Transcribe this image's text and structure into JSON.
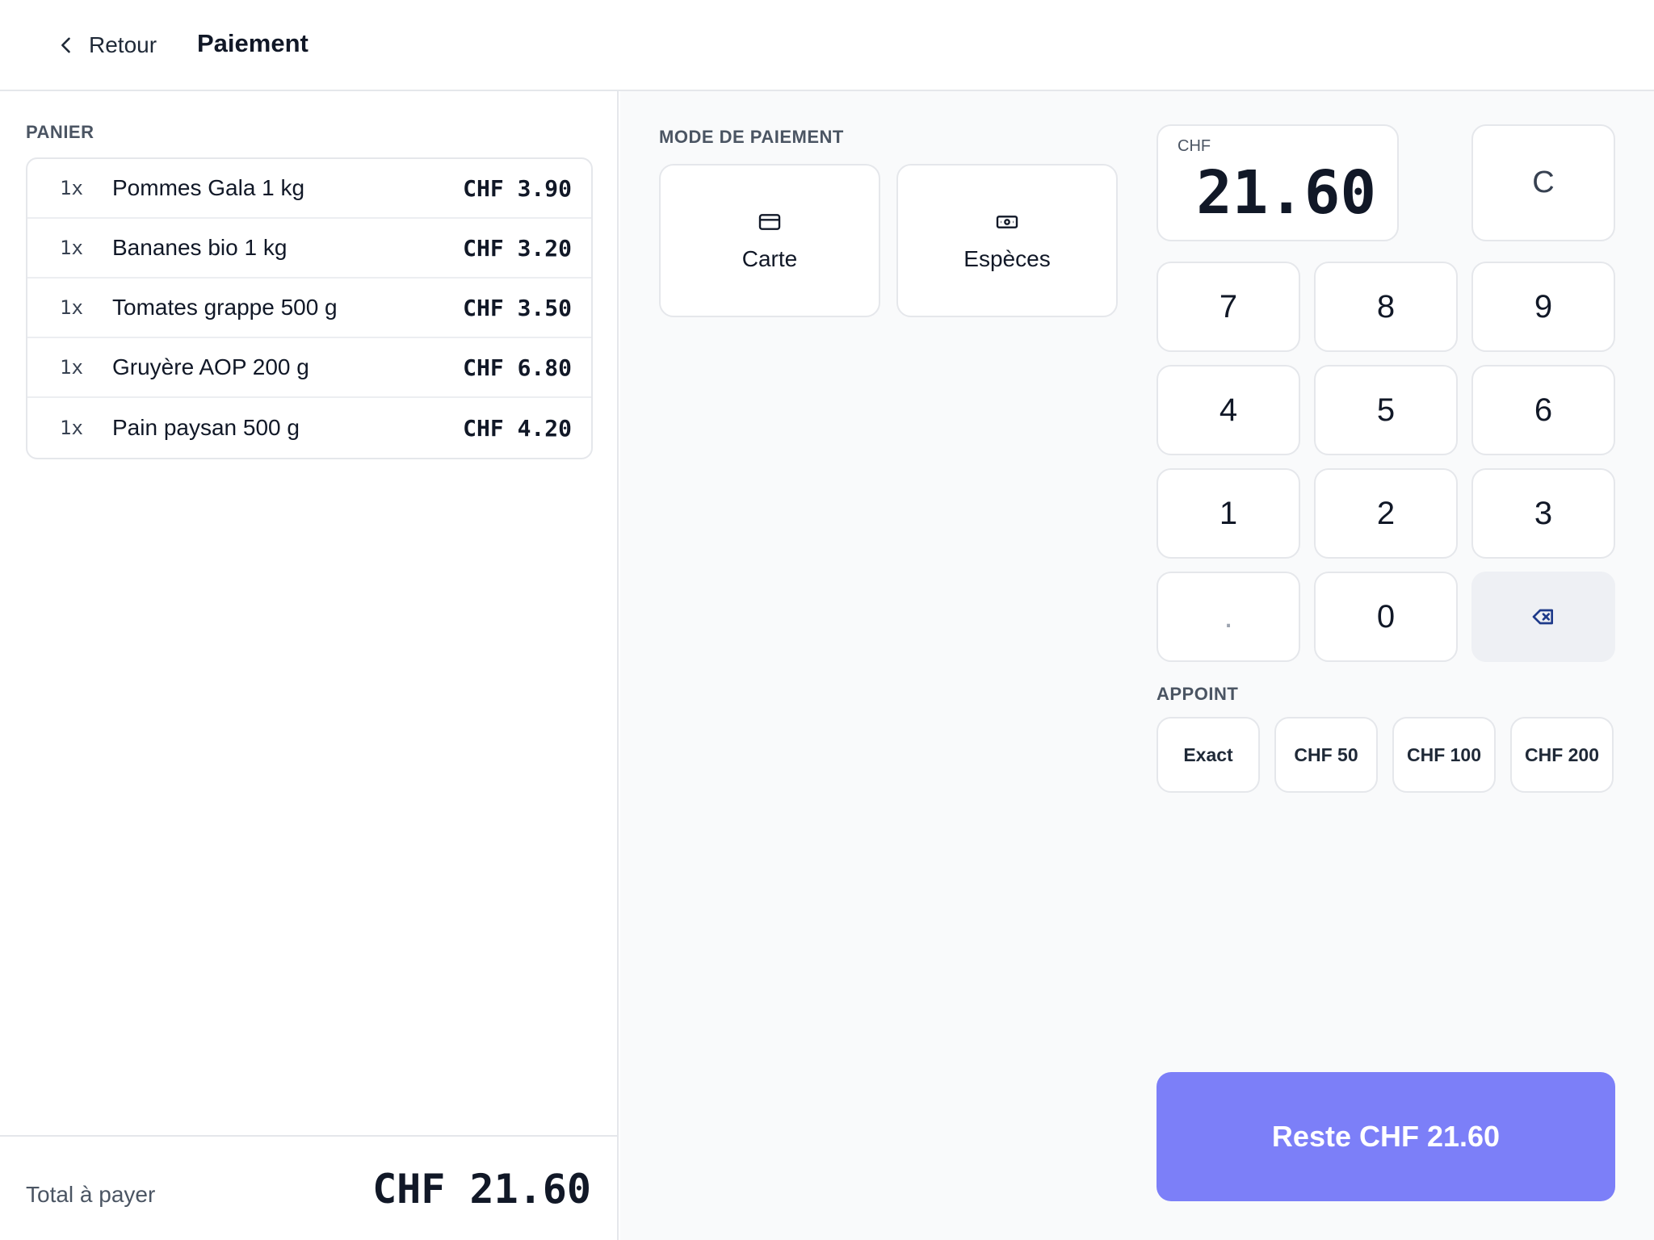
{
  "header": {
    "back_label": "Retour",
    "title": "Paiement"
  },
  "cart": {
    "label": "PANIER",
    "items": [
      {
        "qty": "1x",
        "name": "Pommes Gala 1 kg",
        "price": "CHF 3.90"
      },
      {
        "qty": "1x",
        "name": "Bananes bio 1 kg",
        "price": "CHF 3.20"
      },
      {
        "qty": "1x",
        "name": "Tomates grappe 500 g",
        "price": "CHF 3.50"
      },
      {
        "qty": "1x",
        "name": "Gruyère AOP 200 g",
        "price": "CHF 6.80"
      },
      {
        "qty": "1x",
        "name": "Pain paysan 500 g",
        "price": "CHF 4.20"
      }
    ],
    "total_label": "Total à payer",
    "total_value": "CHF 21.60"
  },
  "payment": {
    "label": "MODE DE PAIEMENT",
    "methods": [
      {
        "label": "Carte",
        "icon": "credit-card-icon"
      },
      {
        "label": "Espèces",
        "icon": "cash-icon"
      }
    ]
  },
  "keypad": {
    "currency": "CHF",
    "amount": "21.60",
    "clear_label": "C",
    "keys": [
      "7",
      "8",
      "9",
      "4",
      "5",
      "6",
      "1",
      "2",
      "3",
      ".",
      "0"
    ],
    "backspace_icon": "backspace-icon"
  },
  "appoint": {
    "label": "APPOINT",
    "options": [
      "Exact",
      "CHF 50",
      "CHF 100",
      "CHF 200"
    ]
  },
  "confirm": {
    "label": "Reste CHF 21.60"
  },
  "colors": {
    "accent": "#7c7ff8",
    "backspace_icon": "#1e3a8a",
    "panel_bg": "#f9fafb",
    "border": "#e5e7eb"
  }
}
